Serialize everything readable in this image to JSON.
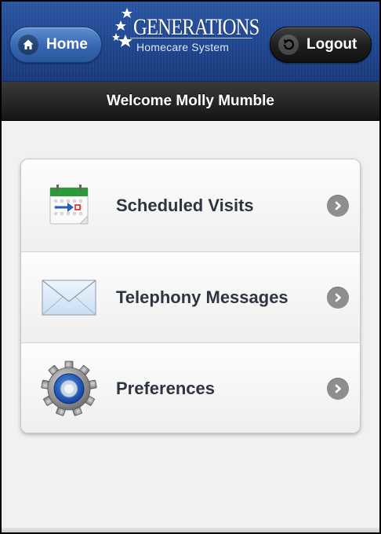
{
  "header": {
    "home_label": "Home",
    "logout_label": "Logout",
    "logo_title": "GENERATIONS",
    "logo_subtitle": "Homecare System"
  },
  "welcome": {
    "text": "Welcome Molly Mumble"
  },
  "menu": {
    "items": [
      {
        "label": "Scheduled Visits",
        "icon": "calendar-icon"
      },
      {
        "label": "Telephony Messages",
        "icon": "envelope-icon"
      },
      {
        "label": "Preferences",
        "icon": "gear-icon"
      }
    ]
  },
  "colors": {
    "header_blue": "#1f4690",
    "welcome_bar": "#1e1e1e",
    "home_button": "#3566b0",
    "logout_button": "#1d1d1d",
    "arrow": "#8e8e8e"
  }
}
